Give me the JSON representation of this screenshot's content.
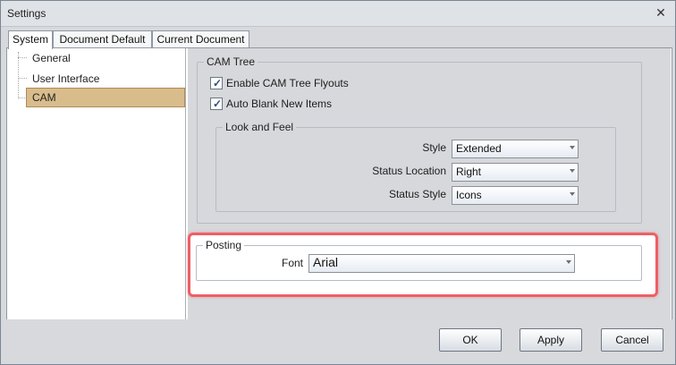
{
  "window": {
    "title": "Settings"
  },
  "tabs": [
    "System",
    "Document Default",
    "Current Document"
  ],
  "tree": {
    "items": [
      "General",
      "User Interface",
      "CAM"
    ],
    "selected": "CAM"
  },
  "cam_tree": {
    "title": "CAM Tree",
    "checkboxes": [
      {
        "label": "Enable CAM Tree Flyouts",
        "checked": true
      },
      {
        "label": "Auto Blank New Items",
        "checked": true
      }
    ],
    "look_and_feel": {
      "title": "Look and Feel",
      "fields": [
        {
          "label": "Style",
          "value": "Extended"
        },
        {
          "label": "Status Location",
          "value": "Right"
        },
        {
          "label": "Status Style",
          "value": "Icons"
        }
      ]
    }
  },
  "posting": {
    "title": "Posting",
    "font_label": "Font",
    "font_value": "Arial"
  },
  "buttons": {
    "ok": "OK",
    "apply": "Apply",
    "cancel": "Cancel"
  },
  "icons": {
    "close": "close-icon",
    "checkbox": "check-icon",
    "dropdown": "chevron-down-icon"
  }
}
